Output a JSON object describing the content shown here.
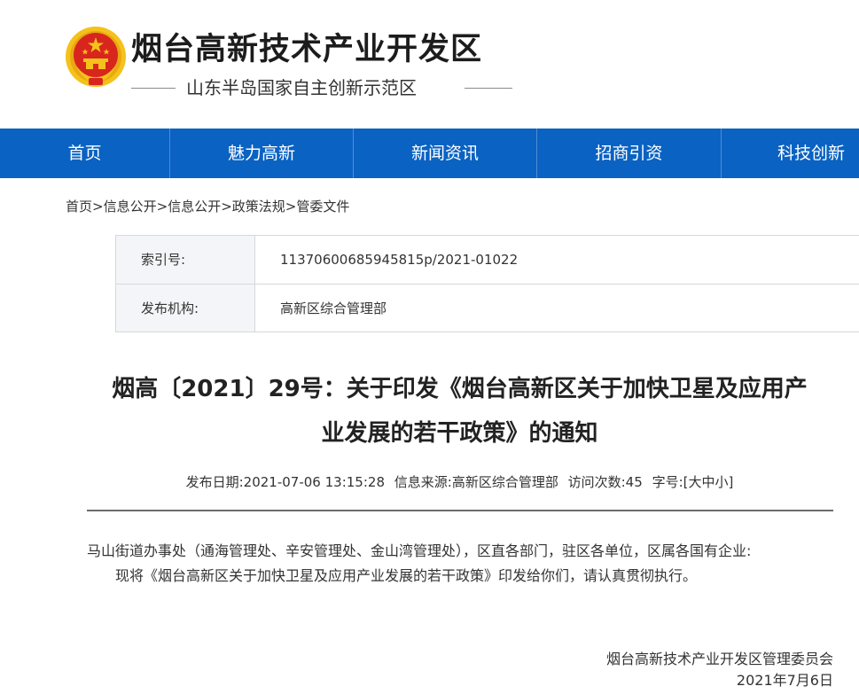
{
  "header": {
    "title": "烟台高新技术产业开发区",
    "subtitle": "山东半岛国家自主创新示范区"
  },
  "nav": {
    "items": [
      {
        "label": "首页"
      },
      {
        "label": "魅力高新"
      },
      {
        "label": "新闻资讯"
      },
      {
        "label": "招商引资"
      },
      {
        "label": "科技创新"
      }
    ]
  },
  "breadcrumb": {
    "items": [
      "首页",
      "信息公开",
      "信息公开",
      "政策法规",
      "管委文件"
    ],
    "separator": ">"
  },
  "meta": {
    "rows": [
      {
        "key": "索引号:",
        "value": "11370600685945815p/2021-01022"
      },
      {
        "key": "发布机构:",
        "value": "高新区综合管理部"
      }
    ]
  },
  "article": {
    "title_line1": "烟高〔2021〕29号：关于印发《烟台高新区关于加快卫星及应用产",
    "title_line2": "业发展的若干政策》的通知",
    "info": {
      "date": "发布日期:2021-07-06 13:15:28",
      "source": "信息来源:高新区综合管理部",
      "visits": "访问次数:45",
      "fontsize_label": "字号:[",
      "size_large": "大",
      "size_medium": "中",
      "size_small": "小",
      "fontsize_end": "]"
    },
    "salutation": "马山街道办事处（通海管理处、辛安管理处、金山湾管理处），区直各部门，驻区各单位，区属各国有企业:",
    "paragraph": "现将《烟台高新区关于加快卫星及应用产业发展的若干政策》印发给你们，请认真贯彻执行。",
    "signature_org": "烟台高新技术产业开发区管理委员会",
    "signature_date": "2021年7月6日"
  },
  "colors": {
    "nav_bg": "#0a62c2",
    "emblem_red": "#d8261e",
    "emblem_gold": "#f4c21a"
  }
}
